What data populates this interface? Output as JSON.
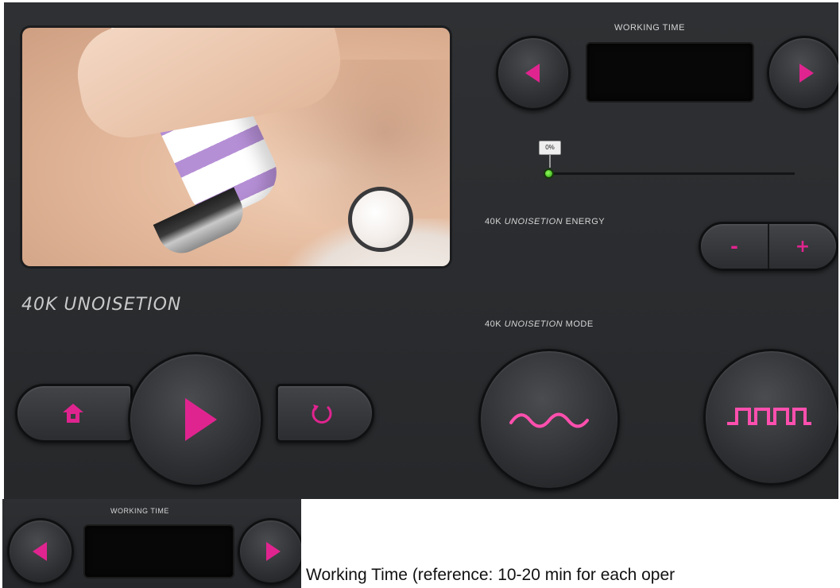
{
  "panel": {
    "title": "40K UNOISETION",
    "working_time_label": "WORKING TIME",
    "slider_value": "0%",
    "energy_label_prefix": "40K",
    "energy_label_italic": "UNOISETION",
    "energy_label_suffix": "ENERGY",
    "mode_label_prefix": "40K",
    "mode_label_italic": "UNOISETION",
    "mode_label_suffix": "MODE",
    "minus_label": "-",
    "plus_label": "+"
  },
  "mini_panel": {
    "working_time_label": "WORKING TIME"
  },
  "caption": "Working Time (reference: 10-20 min for each oper",
  "colors": {
    "accent": "#e0248f",
    "panel_bg": "#2c2e31",
    "display_bg": "#070707",
    "slider_knob": "#3fbf1f"
  }
}
